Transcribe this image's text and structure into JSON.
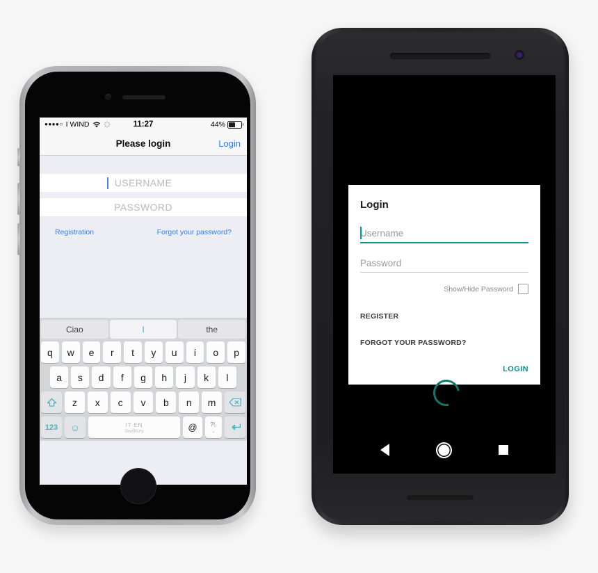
{
  "ios": {
    "status": {
      "signal_dots": "●●●●○",
      "carrier": "I WIND",
      "wifi_icon": "wifi-icon",
      "activity_icon": "activity-icon",
      "time": "11:27",
      "battery_pct": "44%"
    },
    "nav": {
      "title": "Please login",
      "action": "Login"
    },
    "fields": {
      "username_placeholder": "USERNAME",
      "password_placeholder": "PASSWORD"
    },
    "links": {
      "registration": "Registration",
      "forgot": "Forgot your password?"
    },
    "keyboard": {
      "suggestions": [
        "Ciao",
        "I",
        "the"
      ],
      "row1": [
        "q",
        "w",
        "e",
        "r",
        "t",
        "y",
        "u",
        "i",
        "o",
        "p"
      ],
      "row2": [
        "a",
        "s",
        "d",
        "f",
        "g",
        "h",
        "j",
        "k",
        "l"
      ],
      "row3": [
        "z",
        "x",
        "c",
        "v",
        "b",
        "n",
        "m"
      ],
      "shift_icon": "shift-icon",
      "backspace_icon": "backspace-icon",
      "numbers_key": "123",
      "emoji_icon": "emoji-icon",
      "space_languages": "IT EN",
      "space_brand": "SwiftKey",
      "at_key": "@",
      "sym_key_top": "?!,",
      "sym_key_bottom": ".",
      "return_icon": "return-icon"
    }
  },
  "android": {
    "card": {
      "title": "Login",
      "username_placeholder": "Username",
      "password_placeholder": "Password",
      "show_hide_label": "Show/Hide Password",
      "register": "REGISTER",
      "forgot": "FORGOT YOUR PASSWORD?",
      "login": "LOGIN"
    },
    "nav": {
      "back_icon": "back-triangle-icon",
      "home_icon": "home-circle-icon",
      "recents_icon": "recents-square-icon"
    },
    "spinner": "loading-spinner"
  },
  "colors": {
    "ios_accent": "#2f7df6",
    "android_accent": "#009688",
    "spinner": "#0d7a70",
    "ios_bg": "#eceef3"
  }
}
